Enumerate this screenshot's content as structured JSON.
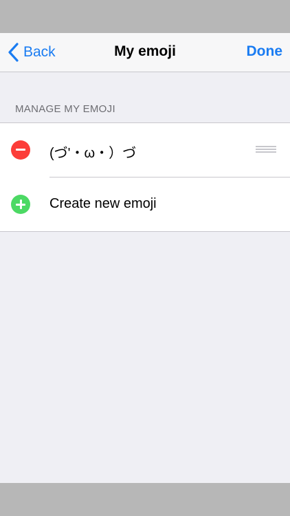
{
  "navbar": {
    "back_label": "Back",
    "title": "My emoji",
    "done_label": "Done"
  },
  "section": {
    "header": "MANAGE MY EMOJI"
  },
  "rows": [
    {
      "label": "(づ'・ω・）づ",
      "action": "delete"
    },
    {
      "label": "Create new emoji",
      "action": "add"
    }
  ],
  "colors": {
    "accent": "#1a7cf2",
    "delete": "#fc3d39",
    "add": "#4cd964",
    "background": "#efeff4"
  },
  "icons": {
    "back": "chevron-left-icon",
    "delete": "minus-circle-icon",
    "add": "plus-circle-icon",
    "reorder": "reorder-handle-icon"
  }
}
